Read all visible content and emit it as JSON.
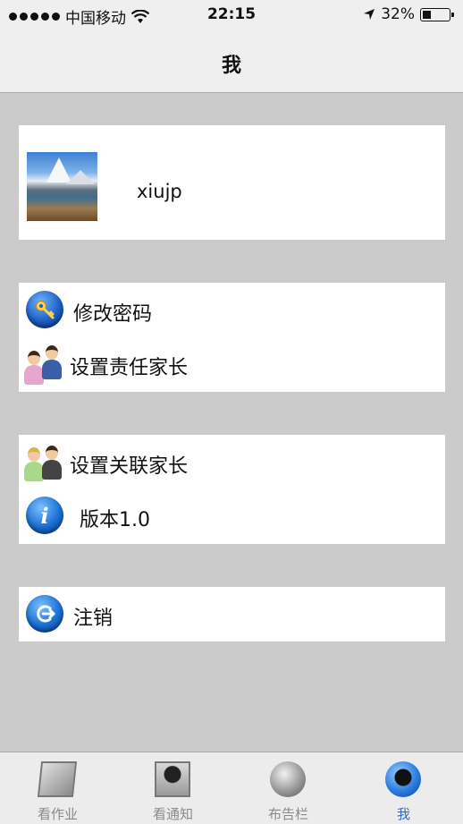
{
  "status_bar": {
    "carrier": "中国移动",
    "time": "22:15",
    "battery": "32%"
  },
  "nav": {
    "title": "我"
  },
  "profile": {
    "username": "xiujp"
  },
  "menu": {
    "change_password": "修改密码",
    "set_responsible_parent": "设置责任家长",
    "set_linked_parent": "设置关联家长",
    "version": "版本1.0",
    "logout": "注销"
  },
  "tabs": [
    {
      "label": "看作业",
      "icon": "homework-icon"
    },
    {
      "label": "看通知",
      "icon": "notice-icon"
    },
    {
      "label": "布告栏",
      "icon": "bulletin-icon"
    },
    {
      "label": "我",
      "icon": "me-icon"
    }
  ],
  "colors": {
    "background": "#cbcbcb",
    "active_tab": "#2a6fd6"
  }
}
